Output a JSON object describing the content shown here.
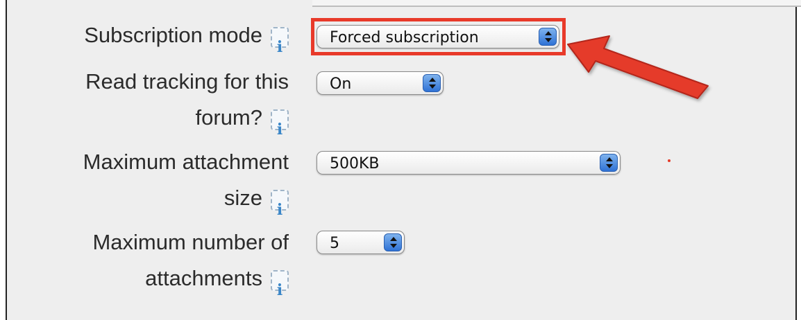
{
  "form": {
    "subscription_mode": {
      "label": "Subscription mode",
      "value": "Forced subscription"
    },
    "read_tracking": {
      "label_line1": "Read tracking for this",
      "label_line2": "forum?",
      "value": "On"
    },
    "max_attachment_size": {
      "label_line1": "Maximum attachment",
      "label_line2": "size",
      "value": "500KB"
    },
    "max_attachments": {
      "label_line1": "Maximum number of",
      "label_line2": "attachments",
      "value": "5"
    }
  },
  "info_icon_glyph": "i",
  "annotation": {
    "highlight_color": "#e83a2a",
    "arrow_color": "#e83a2a"
  }
}
